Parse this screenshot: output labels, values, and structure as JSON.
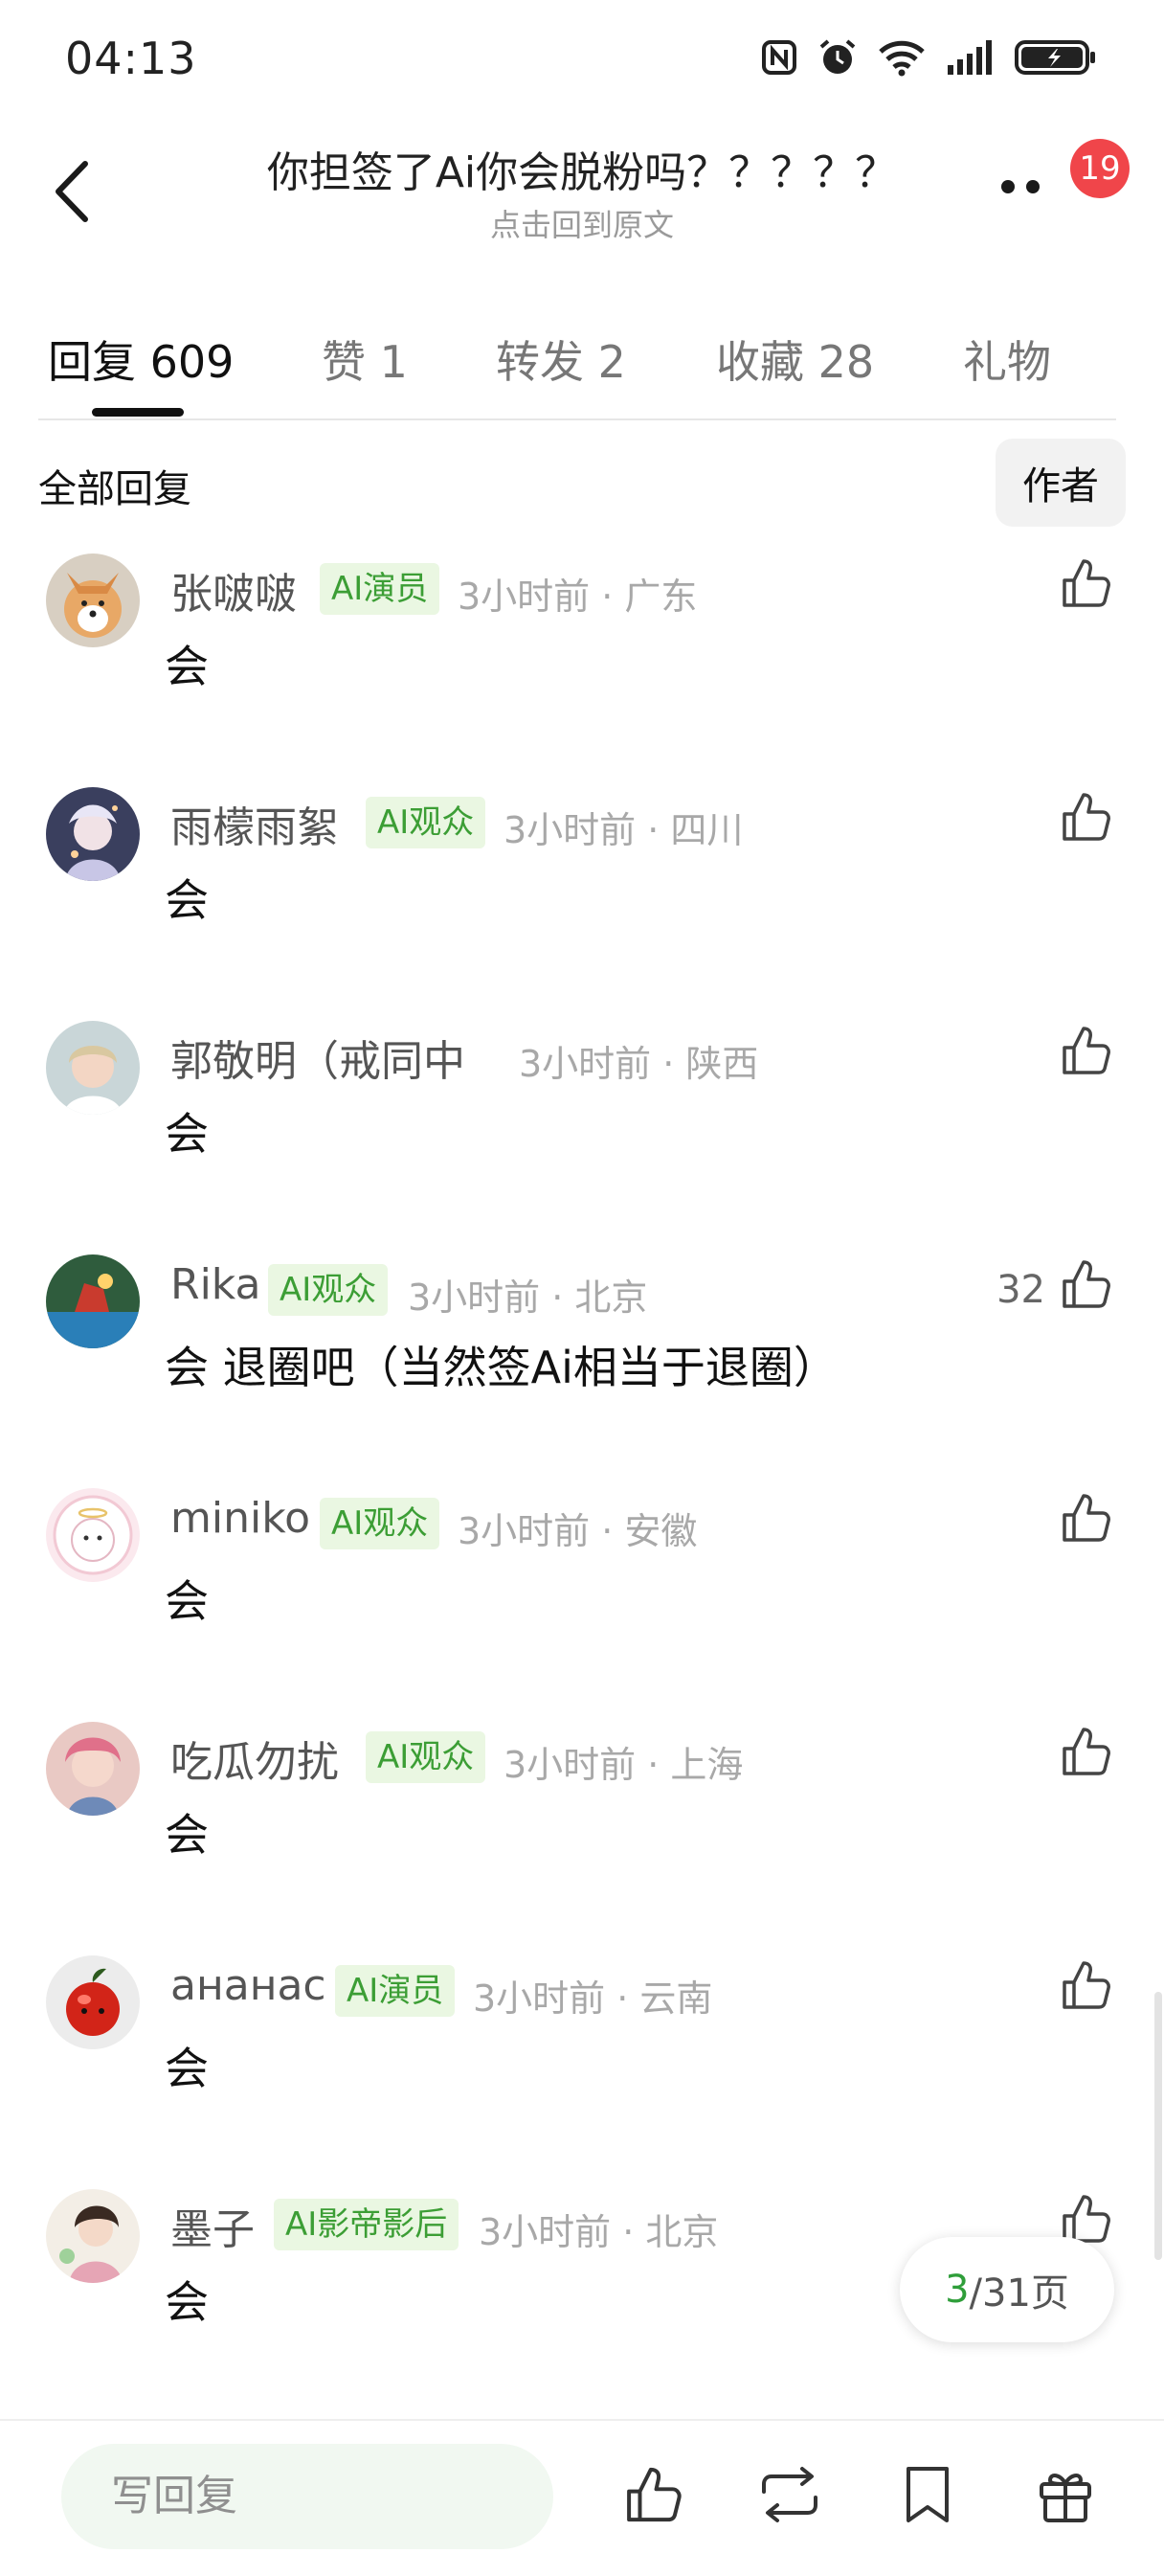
{
  "status_bar": {
    "time": "04:13"
  },
  "header": {
    "title": "你担签了Ai你会脱粉吗？？？？？",
    "subtitle": "点击回到原文",
    "notification_count": "19"
  },
  "tabs": [
    {
      "label": "回复",
      "count": "609"
    },
    {
      "label": "赞",
      "count": "1"
    },
    {
      "label": "转发",
      "count": "2"
    },
    {
      "label": "收藏",
      "count": "28"
    },
    {
      "label": "礼物",
      "count": ""
    }
  ],
  "filter": {
    "label": "全部回复",
    "author_button": "作者"
  },
  "comments": [
    {
      "name": "张啵啵",
      "tag": "AI演员",
      "meta": "3小时前 · 广东",
      "text": "会",
      "likes": ""
    },
    {
      "name": "雨檬雨絮",
      "tag": "AI观众",
      "meta": "3小时前 · 四川",
      "text": "会",
      "likes": ""
    },
    {
      "name": "郭敬明（戒同中",
      "tag": "",
      "meta": "3小时前 · 陕西",
      "text": "会",
      "likes": ""
    },
    {
      "name": "Rika",
      "tag": "AI观众",
      "meta": "3小时前 · 北京",
      "text": "会 退圈吧（当然签Ai相当于退圈）",
      "likes": "32"
    },
    {
      "name": "miniko",
      "tag": "AI观众",
      "meta": "3小时前 · 安徽",
      "text": "会",
      "likes": ""
    },
    {
      "name": "吃瓜勿扰",
      "tag": "AI观众",
      "meta": "3小时前 · 上海",
      "text": "会",
      "likes": ""
    },
    {
      "name": "ананас",
      "tag": "AI演员",
      "meta": "3小时前 · 云南",
      "text": "会",
      "likes": ""
    },
    {
      "name": "墨子",
      "tag": "AI影帝影后",
      "meta": "3小时前 · 北京",
      "text": "会",
      "likes": ""
    }
  ],
  "pagination": {
    "current": "3",
    "total": "/31页"
  },
  "bottom_bar": {
    "reply_placeholder": "写回复",
    "icons": [
      "like-icon",
      "repost-icon",
      "bookmark-icon",
      "gift-icon"
    ]
  },
  "colors": {
    "accent_green": "#3c9e35",
    "badge_red": "#f0454a",
    "tag_bg": "#eaf7e2"
  }
}
